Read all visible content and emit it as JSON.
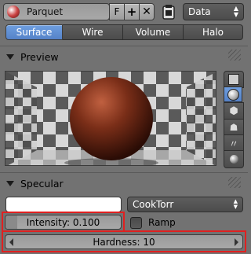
{
  "header": {
    "material_name": "Parquet",
    "fake_user_label": "F",
    "add_icon": "plus-icon",
    "remove_icon": "x-icon",
    "browse_icon": "material-sphere-icon",
    "paste_icon": "clipboard-icon",
    "data_dropdown": "Data"
  },
  "tabs": [
    {
      "label": "Surface",
      "active": true
    },
    {
      "label": "Wire",
      "active": false
    },
    {
      "label": "Volume",
      "active": false
    },
    {
      "label": "Halo",
      "active": false
    }
  ],
  "preview": {
    "title": "Preview",
    "side_buttons": [
      "flat-icon",
      "sphere-icon",
      "cube-icon",
      "monkey-icon",
      "hair-icon",
      "sphere-on-sky-icon"
    ]
  },
  "specular": {
    "title": "Specular",
    "color": "#ffffff",
    "shader": "CookTorr",
    "intensity_label": "Intensity: 0.100",
    "intensity_value": 0.1,
    "ramp_label": "Ramp",
    "ramp_checked": false,
    "hardness_label": "Hardness: 10"
  },
  "colors": {
    "panel_bg": "#727272",
    "active_tab": "#5a8ad0",
    "highlight": "#e02020"
  }
}
